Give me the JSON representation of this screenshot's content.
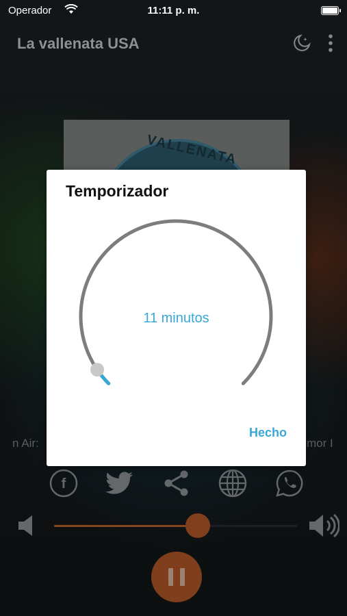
{
  "status_bar": {
    "carrier": "Operador",
    "time": "11:11 p. m."
  },
  "app": {
    "title": "La vallenata USA"
  },
  "artwork": {
    "text": "VALLENATA"
  },
  "ticker": {
    "left": "n Air:",
    "right": "mor I"
  },
  "dialog": {
    "title": "Temporizador",
    "value_text": "11 minutos",
    "done_label": "Hecho",
    "progress_fraction": 0.04
  },
  "share": [
    "facebook-icon",
    "twitter-icon",
    "share-icon",
    "globe-icon",
    "whatsapp-icon"
  ],
  "volume": {
    "level": 0.59
  },
  "colors": {
    "accent": "#39a7d6",
    "player_orange": "#c5622b"
  }
}
